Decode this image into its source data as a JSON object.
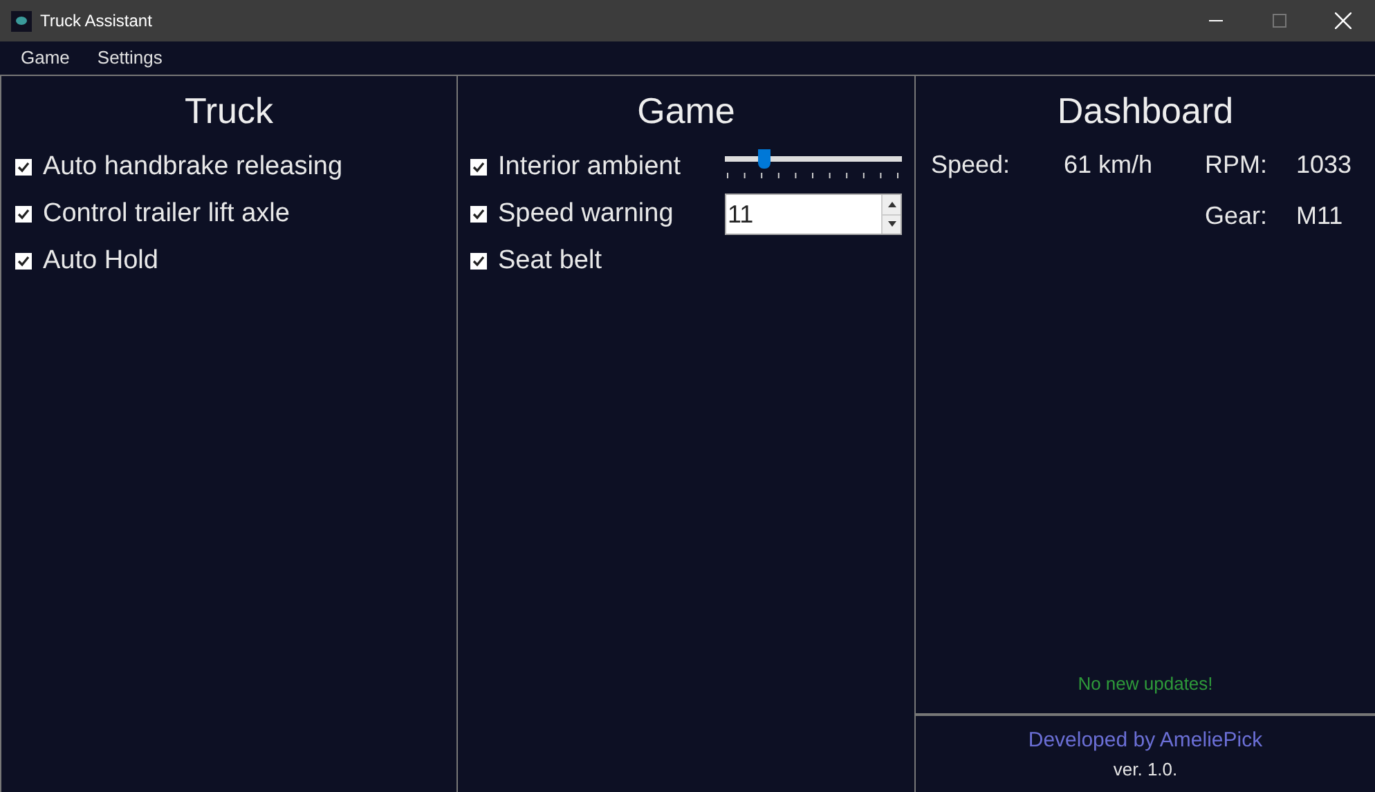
{
  "window": {
    "title": "Truck Assistant",
    "maximize_disabled": true
  },
  "menu": [
    "Game",
    "Settings"
  ],
  "truck": {
    "title": "Truck",
    "options": [
      {
        "label": "Auto handbrake releasing",
        "checked": true
      },
      {
        "label": "Control trailer lift axle",
        "checked": true
      },
      {
        "label": "Auto Hold",
        "checked": true
      }
    ]
  },
  "game": {
    "title": "Game",
    "options": [
      {
        "kind": "slider",
        "label": "Interior ambient",
        "checked": true,
        "level": 0.22
      },
      {
        "kind": "number",
        "label": "Speed warning",
        "checked": true,
        "value": "11"
      },
      {
        "kind": "plain",
        "label": "Seat belt",
        "checked": true
      }
    ]
  },
  "dashboard": {
    "title": "Dashboard",
    "speed_label": "Speed:",
    "speed": "61 km/h",
    "rpm_label": "RPM:",
    "rpm": "1033",
    "gear_label": "Gear:",
    "gear": "M11",
    "update_status": "No new updates!",
    "credit": "Developed by AmeliePick",
    "version": "ver. 1.0."
  }
}
